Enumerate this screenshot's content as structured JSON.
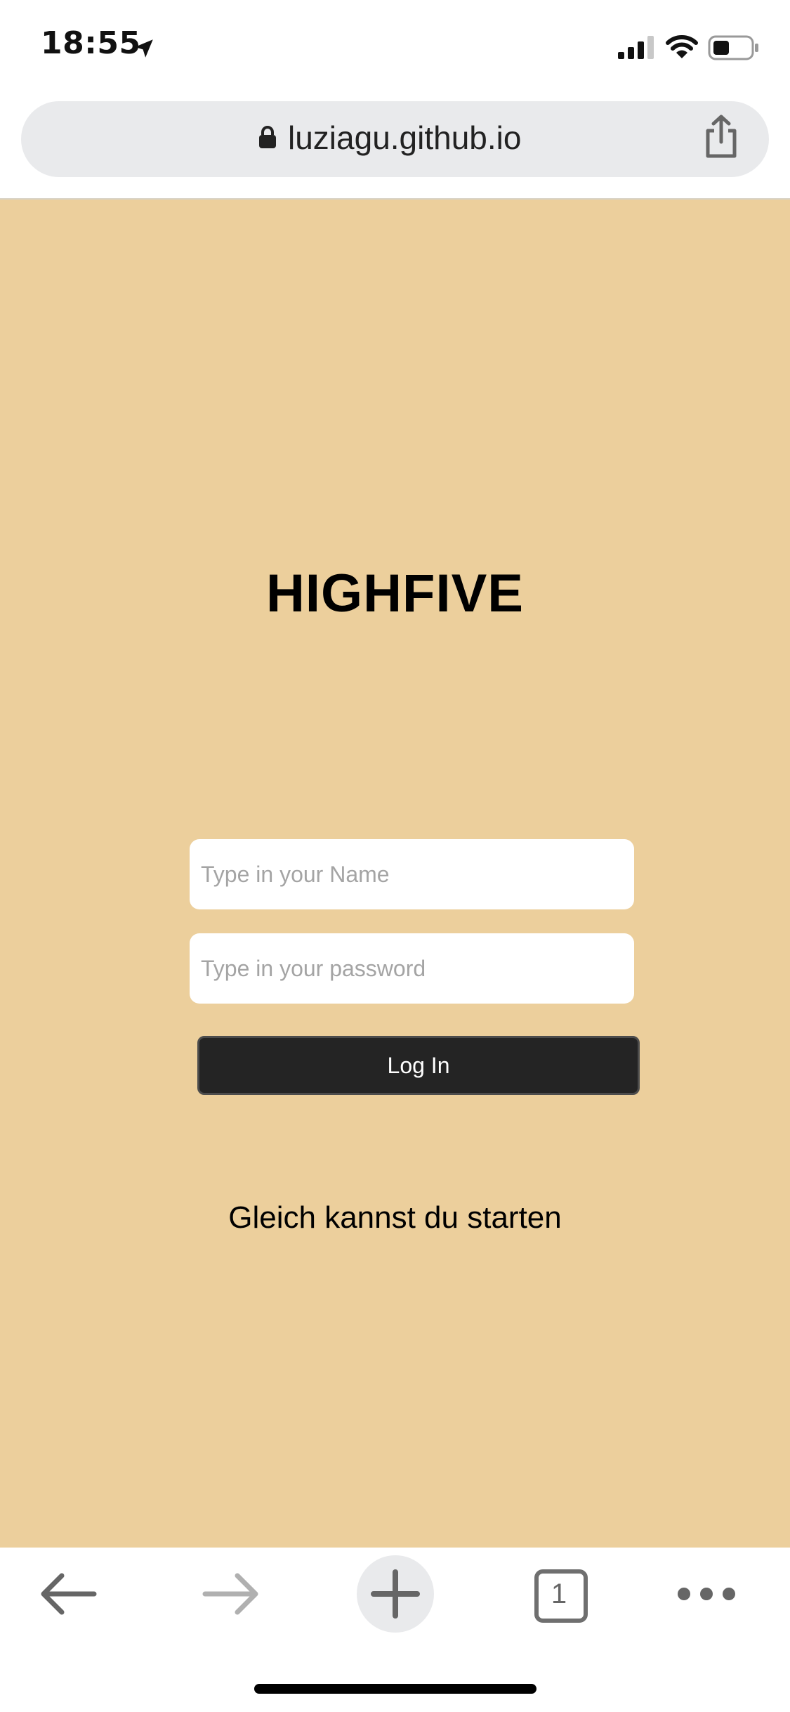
{
  "status_bar": {
    "time": "18:55"
  },
  "browser": {
    "url": "luziagu.github.io",
    "tab_count": "1"
  },
  "page": {
    "title": "HIGHFIVE",
    "name_placeholder": "Type in your Name",
    "password_placeholder": "Type in your password",
    "name_value": "",
    "password_value": "",
    "login_label": "Log In",
    "info_text": "Gleich kannst du starten",
    "background_color": "#eccf9c",
    "button_color": "#242424"
  },
  "icons": {
    "location": "location-arrow-icon",
    "signal": "cellular-signal-icon",
    "wifi": "wifi-icon",
    "battery": "battery-icon",
    "lock": "lock-icon",
    "share": "share-icon",
    "back": "back-arrow-icon",
    "forward": "forward-arrow-icon",
    "new_tab": "plus-icon",
    "tabs": "tabs-icon",
    "more": "more-dots-icon"
  }
}
